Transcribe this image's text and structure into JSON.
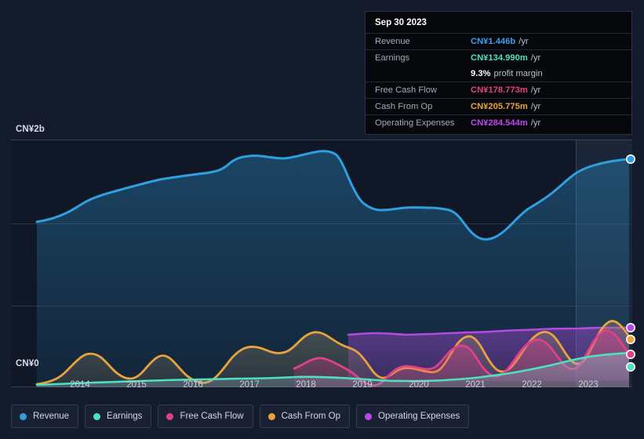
{
  "axis": {
    "y_top_label": "CN¥2b",
    "y_zero_label": "CN¥0",
    "x_labels": [
      "2014",
      "2015",
      "2016",
      "2017",
      "2018",
      "2019",
      "2020",
      "2021",
      "2022",
      "2023"
    ]
  },
  "tooltip": {
    "date": "Sep 30 2023",
    "rows": [
      {
        "label": "Revenue",
        "value": "CN¥1.446b",
        "suffix": "/yr",
        "color": "#3d9fe8"
      },
      {
        "label": "Earnings",
        "value": "CN¥134.990m",
        "suffix": "/yr",
        "color": "#4fe0c0"
      },
      {
        "label": "",
        "value": "9.3%",
        "suffix": "profit margin",
        "color": "#ffffff"
      },
      {
        "label": "Free Cash Flow",
        "value": "CN¥178.773m",
        "suffix": "/yr",
        "color": "#e8407f"
      },
      {
        "label": "Cash From Op",
        "value": "CN¥205.775m",
        "suffix": "/yr",
        "color": "#e8a33d"
      },
      {
        "label": "Operating Expenses",
        "value": "CN¥284.544m",
        "suffix": "/yr",
        "color": "#bb4ae8"
      }
    ]
  },
  "legend": {
    "items": [
      {
        "label": "Revenue",
        "color": "#2f9fdf"
      },
      {
        "label": "Earnings",
        "color": "#4fe0c0"
      },
      {
        "label": "Free Cash Flow",
        "color": "#e0408a"
      },
      {
        "label": "Cash From Op",
        "color": "#e8a33d"
      },
      {
        "label": "Operating Expenses",
        "color": "#b44ae0"
      }
    ]
  },
  "chart_data": {
    "type": "area",
    "title": "",
    "xlabel": "",
    "ylabel": "CN¥",
    "ylim": [
      0,
      2000000000
    ],
    "y_ticks": [
      0,
      2000000000
    ],
    "y_tick_labels": [
      "CN¥0",
      "CN¥2b"
    ],
    "grid": true,
    "gridlines_y": [
      0,
      500000000,
      1000000000,
      2000000000
    ],
    "legend_position": "bottom",
    "x_range": [
      "2013-06",
      "2023-09"
    ],
    "x_tick_labels": [
      "2014",
      "2015",
      "2016",
      "2017",
      "2018",
      "2019",
      "2020",
      "2021",
      "2022",
      "2023"
    ],
    "forecast_band_start": "2022-10",
    "currency": "CNY",
    "units": "CN¥ (billions/millions per year, trailing twelve months)",
    "series": [
      {
        "name": "Revenue",
        "color": "#2f9fdf",
        "values_billions": [
          1.17,
          1.19,
          1.22,
          1.27,
          1.32,
          1.35,
          1.37,
          1.4,
          1.43,
          1.46,
          1.49,
          1.52,
          1.54,
          1.56,
          1.57,
          1.57,
          1.58,
          1.59,
          1.62,
          1.7,
          1.71,
          1.7,
          1.71,
          1.72,
          1.72,
          1.73,
          1.75,
          1.78,
          1.79,
          1.78,
          1.73,
          1.62,
          1.51,
          1.48,
          1.47,
          1.48,
          1.49,
          1.48,
          1.49,
          1.49,
          1.48,
          1.47,
          1.48,
          1.5,
          1.47,
          1.42,
          1.37,
          1.35,
          1.35,
          1.37,
          1.4,
          1.43,
          1.47,
          1.5,
          1.47,
          1.43,
          1.4,
          1.39,
          1.41,
          1.44,
          1.48,
          1.53,
          1.58,
          1.63,
          1.66,
          1.69,
          1.72,
          1.75,
          1.446
        ]
      },
      {
        "name": "Earnings",
        "color": "#4fe0c0",
        "values_millions": [
          30,
          32,
          34,
          36,
          38,
          40,
          42,
          44,
          46,
          48,
          50,
          52,
          54,
          55,
          56,
          57,
          58,
          59,
          60,
          62,
          64,
          65,
          66,
          67,
          68,
          69,
          70,
          72,
          76,
          82,
          88,
          92,
          94,
          92,
          84,
          70,
          56,
          48,
          45,
          44,
          44,
          45,
          46,
          48,
          50,
          52,
          54,
          56,
          58,
          60,
          63,
          66,
          70,
          74,
          78,
          82,
          86,
          90,
          96,
          104,
          112,
          120,
          126,
          130,
          132,
          133,
          134,
          135,
          134.99
        ]
      },
      {
        "name": "Free Cash Flow",
        "color": "#e0408a",
        "start_index": 45,
        "values_millions": [
          115,
          120,
          128,
          122,
          100,
          70,
          40,
          20,
          12,
          25,
          60,
          110,
          155,
          180,
          190,
          192,
          185,
          120,
          90,
          140,
          210,
          255,
          230,
          175,
          130,
          115,
          140,
          195,
          245,
          230,
          185,
          178.773
        ]
      },
      {
        "name": "Cash From Op",
        "color": "#e8a33d",
        "values_millions": [
          8,
          12,
          20,
          35,
          60,
          95,
          125,
          140,
          135,
          115,
          85,
          62,
          58,
          72,
          98,
          122,
          130,
          118,
          92,
          65,
          42,
          30,
          34,
          58,
          92,
          130,
          160,
          180,
          186,
          178,
          172,
          180,
          200,
          225,
          250,
          262,
          248,
          218,
          198,
          205,
          228,
          240,
          238,
          228,
          198,
          148,
          128,
          133,
          140,
          132,
          100,
          72,
          52,
          60,
          100,
          148,
          190,
          218,
          228,
          222,
          150,
          118,
          175,
          250,
          290,
          268,
          212,
          172,
          205.775
        ]
      },
      {
        "name": "Operating Expenses",
        "color": "#b44ae0",
        "start_index": 53,
        "values_millions": [
          262,
          263,
          264,
          264,
          263,
          262,
          261,
          262,
          263,
          264,
          265,
          266,
          267,
          268,
          269,
          270,
          271,
          272,
          273,
          275,
          277,
          279,
          281,
          283,
          284.544
        ]
      }
    ]
  }
}
